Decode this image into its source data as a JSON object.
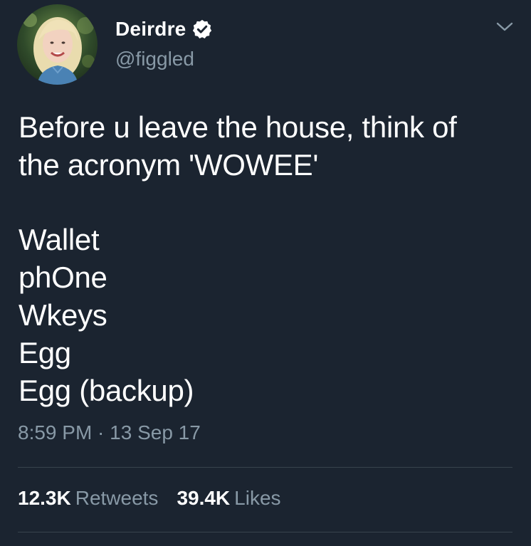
{
  "author": {
    "display_name": "Deirdre",
    "handle": "@figgled",
    "verified_icon": "verified-badge-icon"
  },
  "tweet": {
    "text_lines": [
      "Before u leave the house, think of",
      "the acronym 'WOWEE'"
    ],
    "list_items": [
      "Wallet",
      "phOne",
      "Wkeys",
      "Egg",
      "Egg (backup)"
    ],
    "timestamp": "8:59 PM · 13 Sep 17"
  },
  "stats": {
    "retweets_count": "12.3K",
    "retweets_label": "Retweets",
    "likes_count": "39.4K",
    "likes_label": "Likes"
  },
  "colors": {
    "background": "#1b2430",
    "text": "#ffffff",
    "secondary_text": "#8899a6",
    "divider": "#38444d"
  }
}
